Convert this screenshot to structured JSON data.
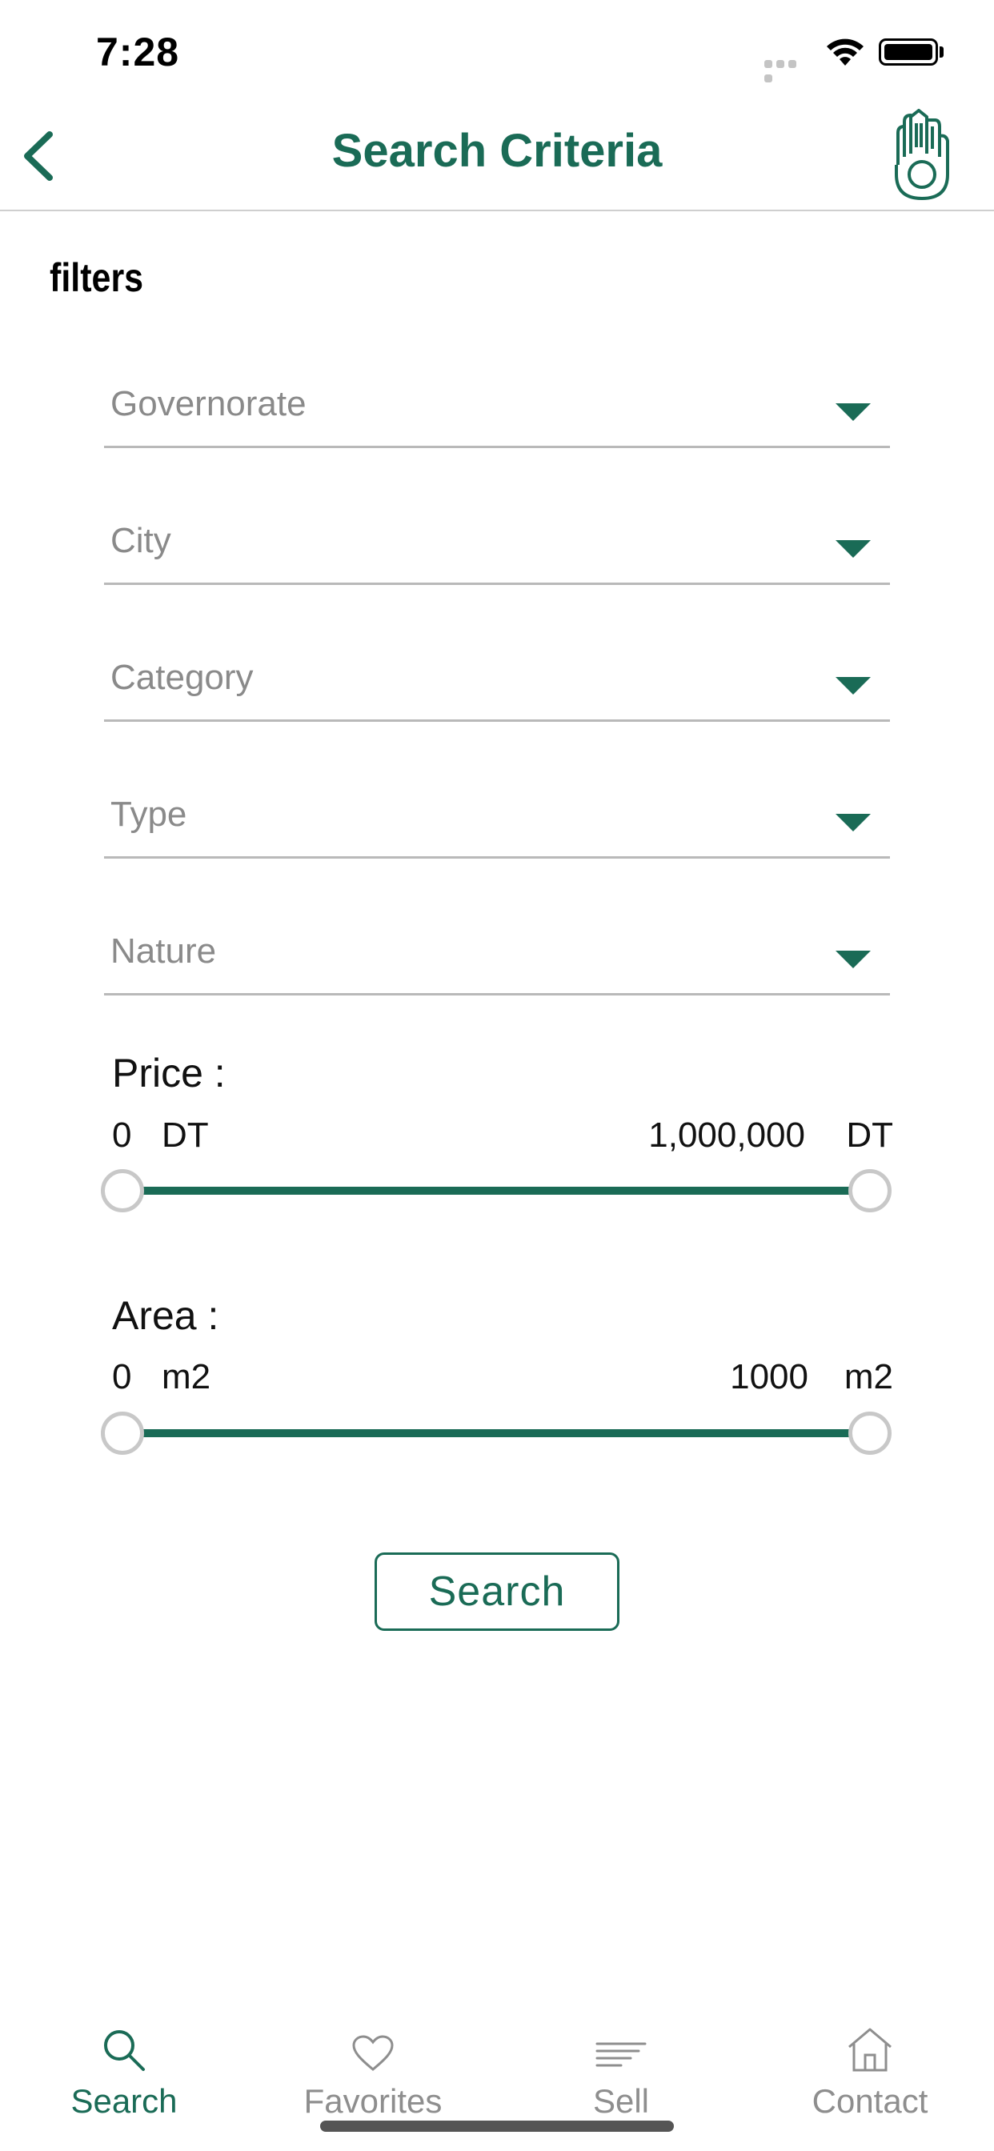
{
  "status_bar": {
    "time": "7:28"
  },
  "nav": {
    "title": "Search Criteria"
  },
  "filters": {
    "heading": "filters",
    "dropdowns": [
      {
        "placeholder": "Governorate"
      },
      {
        "placeholder": "City"
      },
      {
        "placeholder": "Category"
      },
      {
        "placeholder": "Type"
      },
      {
        "placeholder": "Nature"
      }
    ]
  },
  "price": {
    "label": "Price :",
    "min": "0",
    "min_unit": "DT",
    "max": "1,000,000",
    "max_unit": "DT",
    "selected_range_fraction": [
      0,
      1
    ]
  },
  "area": {
    "label": "Area :",
    "min": "0",
    "min_unit": "m2",
    "max": "1000",
    "max_unit": "m2",
    "selected_range_fraction": [
      0,
      1
    ]
  },
  "search_button": {
    "label": "Search"
  },
  "tab_bar": {
    "tabs": [
      {
        "label": "Search",
        "icon": "search-icon",
        "active": true
      },
      {
        "label": "Favorites",
        "icon": "heart-icon",
        "active": false
      },
      {
        "label": "Sell",
        "icon": "lines-icon",
        "active": false
      },
      {
        "label": "Contact",
        "icon": "home-icon",
        "active": false
      }
    ]
  },
  "colors": {
    "accent": "#1a6b56",
    "placeholder": "#8a8a8a",
    "divider": "#b9b9b9"
  }
}
